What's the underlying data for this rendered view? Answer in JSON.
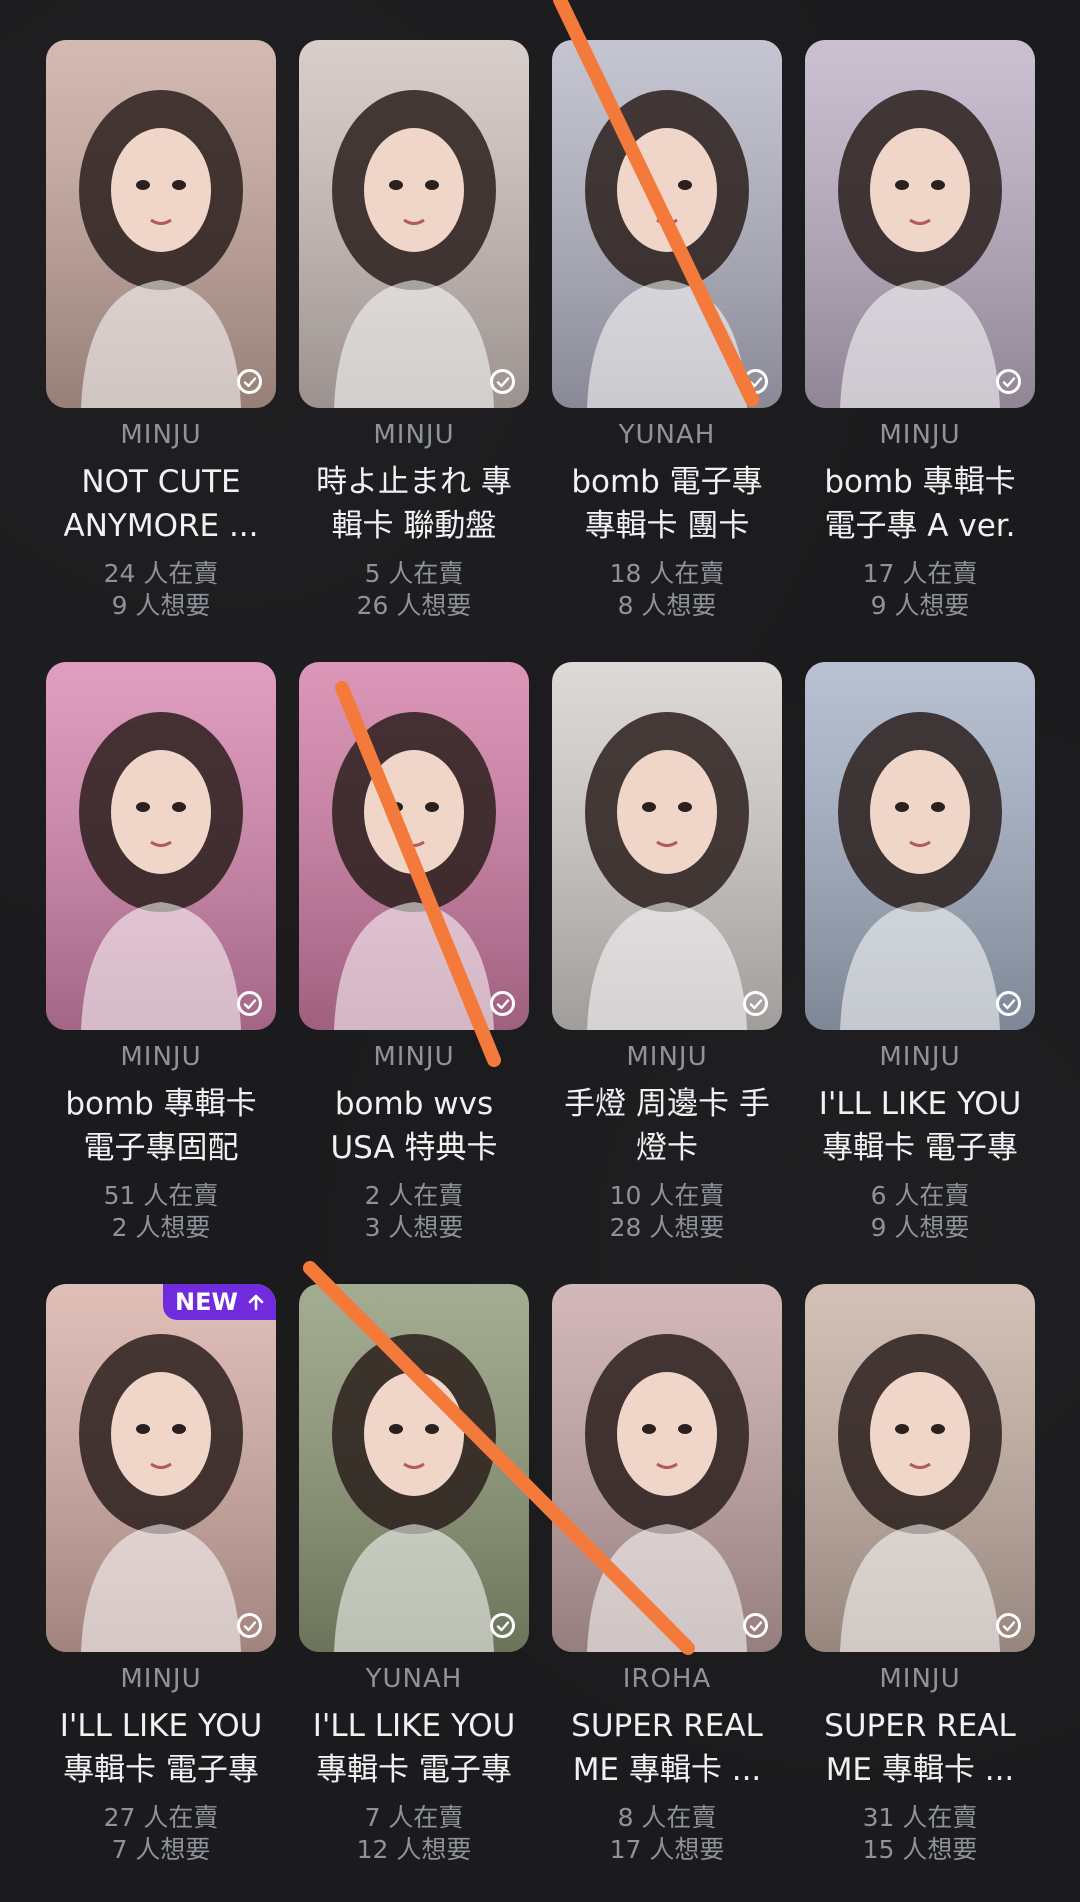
{
  "cards": [
    {
      "member": "MINJU",
      "title": "NOT CUTE\nANYMORE ...",
      "sellers": "24 人在賣",
      "wanters": "9 人想要",
      "crossed": false,
      "bg": "#c9aaa0"
    },
    {
      "member": "MINJU",
      "title": "時よ止まれ 專\n輯卡 聯動盤",
      "sellers": "5 人在賣",
      "wanters": "26 人想要",
      "crossed": false,
      "bg": "#cfc3c0"
    },
    {
      "member": "YUNAH",
      "title": "bomb 電子專\n專輯卡 團卡",
      "sellers": "18 人在賣",
      "wanters": "8 人想要",
      "crossed": true,
      "bg": "#b8b8c8"
    },
    {
      "member": "MINJU",
      "title": "bomb 專輯卡\n電子專 A ver.",
      "sellers": "17 人在賣",
      "wanters": "9 人想要",
      "crossed": false,
      "bg": "#bfb2c7"
    },
    {
      "member": "MINJU",
      "title": "bomb 專輯卡\n電子專固配",
      "sellers": "51 人在賣",
      "wanters": "2 人想要",
      "crossed": false,
      "bg": "#d988b2"
    },
    {
      "member": "MINJU",
      "title": "bomb wvs\nUSA 特典卡",
      "sellers": "2 人在賣",
      "wanters": "3 人想要",
      "crossed": true,
      "bg": "#d47fa8"
    },
    {
      "member": "MINJU",
      "title": "手燈 周邊卡 手\n燈卡",
      "sellers": "10 人在賣",
      "wanters": "28 人想要",
      "crossed": false,
      "bg": "#d6d1cf"
    },
    {
      "member": "MINJU",
      "title": "I'LL LIKE YOU\n專輯卡 電子專",
      "sellers": "6 人在賣",
      "wanters": "9 人想要",
      "crossed": false,
      "bg": "#a8b4c8"
    },
    {
      "member": "MINJU",
      "title": "I'LL LIKE YOU\n專輯卡 電子專",
      "sellers": "27 人在賣",
      "wanters": "7 人想要",
      "crossed": false,
      "bg": "#d8b0a8",
      "badge": "NEW"
    },
    {
      "member": "YUNAH",
      "title": "I'LL LIKE YOU\n專輯卡 電子專",
      "sellers": "7 人在賣",
      "wanters": "12 人想要",
      "crossed": true,
      "bg": "#8f9a78"
    },
    {
      "member": "IROHA",
      "title": "SUPER REAL\nME 專輯卡 ...",
      "sellers": "8 人在賣",
      "wanters": "17 人想要",
      "crossed": true,
      "bg": "#c8a8a8"
    },
    {
      "member": "MINJU",
      "title": "SUPER REAL\nME 專輯卡 ...",
      "sellers": "31 人在賣",
      "wanters": "15 人想要",
      "crossed": false,
      "bg": "#c9b3a7"
    }
  ],
  "colors": {
    "strike": "#f47a3c",
    "badge": "#6f2bdc"
  }
}
